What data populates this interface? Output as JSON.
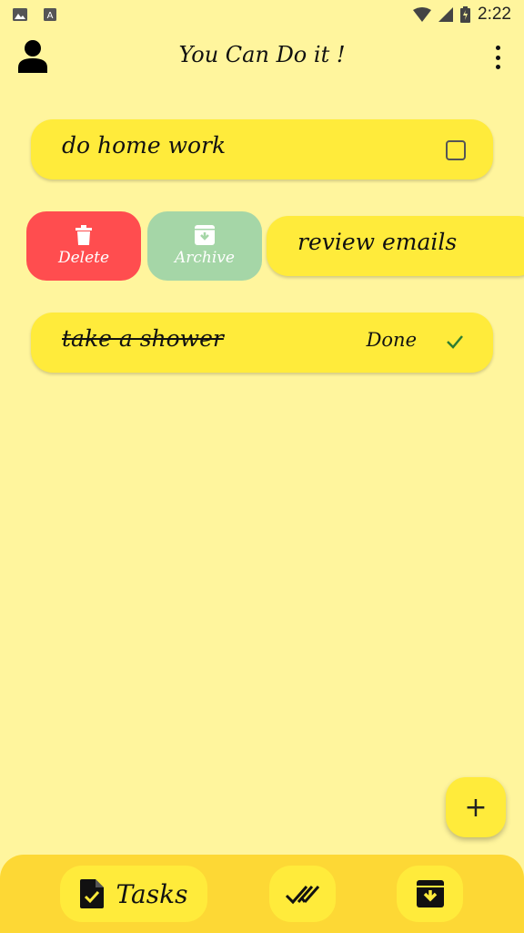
{
  "app": {
    "title": "You Can Do it !"
  },
  "status_bar": {
    "time": "2:22"
  },
  "tasks": [
    {
      "text": "do home work",
      "completed": false
    },
    {
      "text": "review emails",
      "completed": false,
      "swiped": true
    },
    {
      "text": "take a shower",
      "completed": true,
      "status_label": "Done"
    }
  ],
  "swipe_actions": {
    "delete_label": "Delete",
    "archive_label": "Archive",
    "delete_color": "#FF4D4F",
    "archive_color": "#A5D6A7"
  },
  "bottom_nav": {
    "tasks_label": "Tasks"
  },
  "colors": {
    "background": "#FFF59D",
    "card": "#FFEB3B",
    "nav": "#FDD835"
  }
}
